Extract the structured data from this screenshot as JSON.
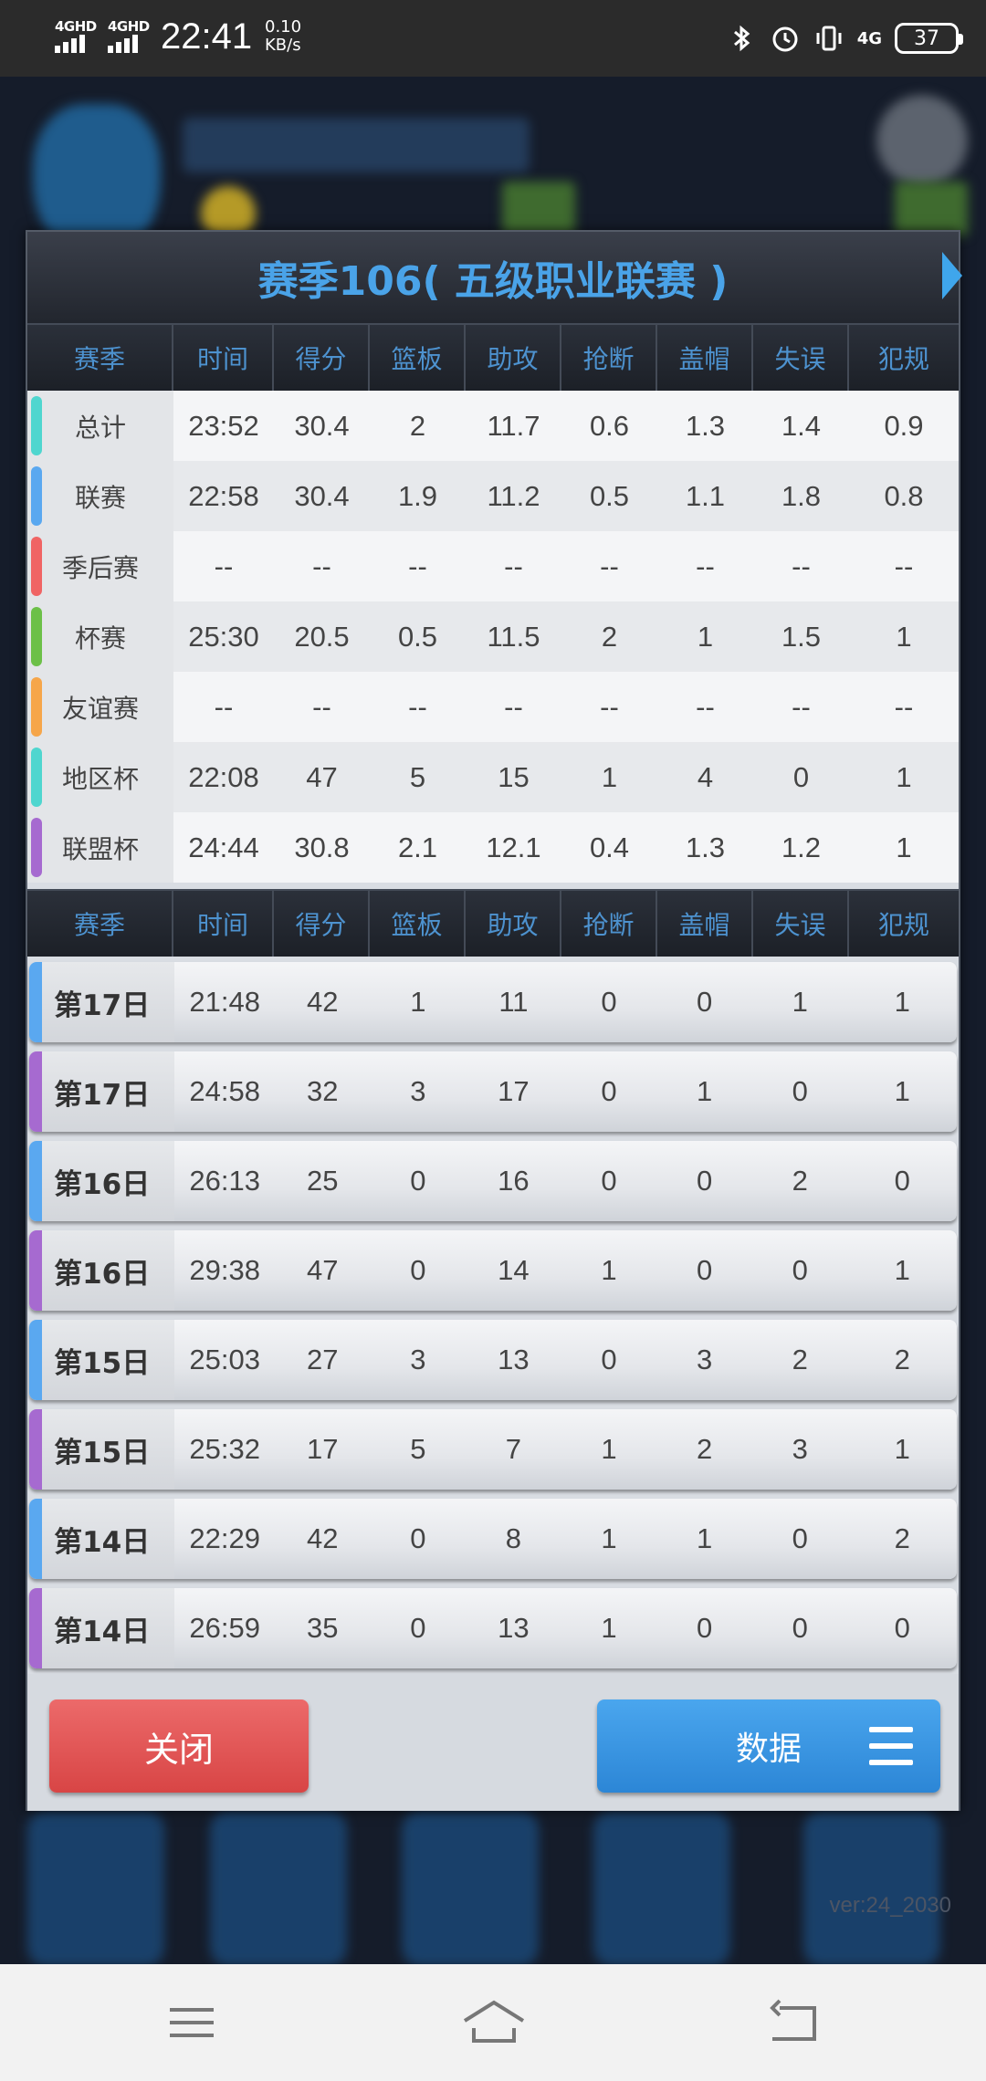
{
  "status_bar": {
    "sim1": "4GHD",
    "sim2": "4GHD",
    "time": "22:41",
    "speed_value": "0.10",
    "speed_unit": "KB/s",
    "network": "4G",
    "battery": "37"
  },
  "dialog": {
    "title": "赛季106( 五级职业联赛 )",
    "summary_headers": [
      "赛季",
      "时间",
      "得分",
      "篮板",
      "助攻",
      "抢断",
      "盖帽",
      "失误",
      "犯规"
    ],
    "summary_rows": [
      {
        "label": "总计",
        "color": "#4fd6cf",
        "values": [
          "23:52",
          "30.4",
          "2",
          "11.7",
          "0.6",
          "1.3",
          "1.4",
          "0.9"
        ]
      },
      {
        "label": "联赛",
        "color": "#5aa8f0",
        "values": [
          "22:58",
          "30.4",
          "1.9",
          "11.2",
          "0.5",
          "1.1",
          "1.8",
          "0.8"
        ]
      },
      {
        "label": "季后赛",
        "color": "#f06464",
        "values": [
          "--",
          "--",
          "--",
          "--",
          "--",
          "--",
          "--",
          "--"
        ]
      },
      {
        "label": "杯赛",
        "color": "#6cc048",
        "values": [
          "25:30",
          "20.5",
          "0.5",
          "11.5",
          "2",
          "1",
          "1.5",
          "1"
        ]
      },
      {
        "label": "友谊赛",
        "color": "#f6a64a",
        "values": [
          "--",
          "--",
          "--",
          "--",
          "--",
          "--",
          "--",
          "--"
        ]
      },
      {
        "label": "地区杯",
        "color": "#4fd6cf",
        "values": [
          "22:08",
          "47",
          "5",
          "15",
          "1",
          "4",
          "0",
          "1"
        ]
      },
      {
        "label": "联盟杯",
        "color": "#a66ad0",
        "values": [
          "24:44",
          "30.8",
          "2.1",
          "12.1",
          "0.4",
          "1.3",
          "1.2",
          "1"
        ]
      }
    ],
    "game_headers": [
      "赛季",
      "时间",
      "得分",
      "篮板",
      "助攻",
      "抢断",
      "盖帽",
      "失误",
      "犯规"
    ],
    "game_rows": [
      {
        "label": "第17日",
        "color": "#5aa8f0",
        "values": [
          "21:48",
          "42",
          "1",
          "11",
          "0",
          "0",
          "1",
          "1"
        ]
      },
      {
        "label": "第17日",
        "color": "#a66ad0",
        "values": [
          "24:58",
          "32",
          "3",
          "17",
          "0",
          "1",
          "0",
          "1"
        ]
      },
      {
        "label": "第16日",
        "color": "#5aa8f0",
        "values": [
          "26:13",
          "25",
          "0",
          "16",
          "0",
          "0",
          "2",
          "0"
        ]
      },
      {
        "label": "第16日",
        "color": "#a66ad0",
        "values": [
          "29:38",
          "47",
          "0",
          "14",
          "1",
          "0",
          "0",
          "1"
        ]
      },
      {
        "label": "第15日",
        "color": "#5aa8f0",
        "values": [
          "25:03",
          "27",
          "3",
          "13",
          "0",
          "3",
          "2",
          "2"
        ]
      },
      {
        "label": "第15日",
        "color": "#a66ad0",
        "values": [
          "25:32",
          "17",
          "5",
          "7",
          "1",
          "2",
          "3",
          "1"
        ]
      },
      {
        "label": "第14日",
        "color": "#5aa8f0",
        "values": [
          "22:29",
          "42",
          "0",
          "8",
          "1",
          "1",
          "0",
          "2"
        ]
      },
      {
        "label": "第14日",
        "color": "#a66ad0",
        "values": [
          "26:59",
          "35",
          "0",
          "13",
          "1",
          "0",
          "0",
          "0"
        ]
      }
    ],
    "close_label": "关闭",
    "data_label": "数据"
  },
  "version": "ver:24_2030",
  "icons": {
    "bluetooth": "bluetooth-icon",
    "alarm": "alarm-icon",
    "vibrate": "vibrate-icon",
    "menu": "menu-icon",
    "nav_menu": "nav-menu-icon",
    "nav_home": "nav-home-icon",
    "nav_back": "nav-back-icon"
  }
}
